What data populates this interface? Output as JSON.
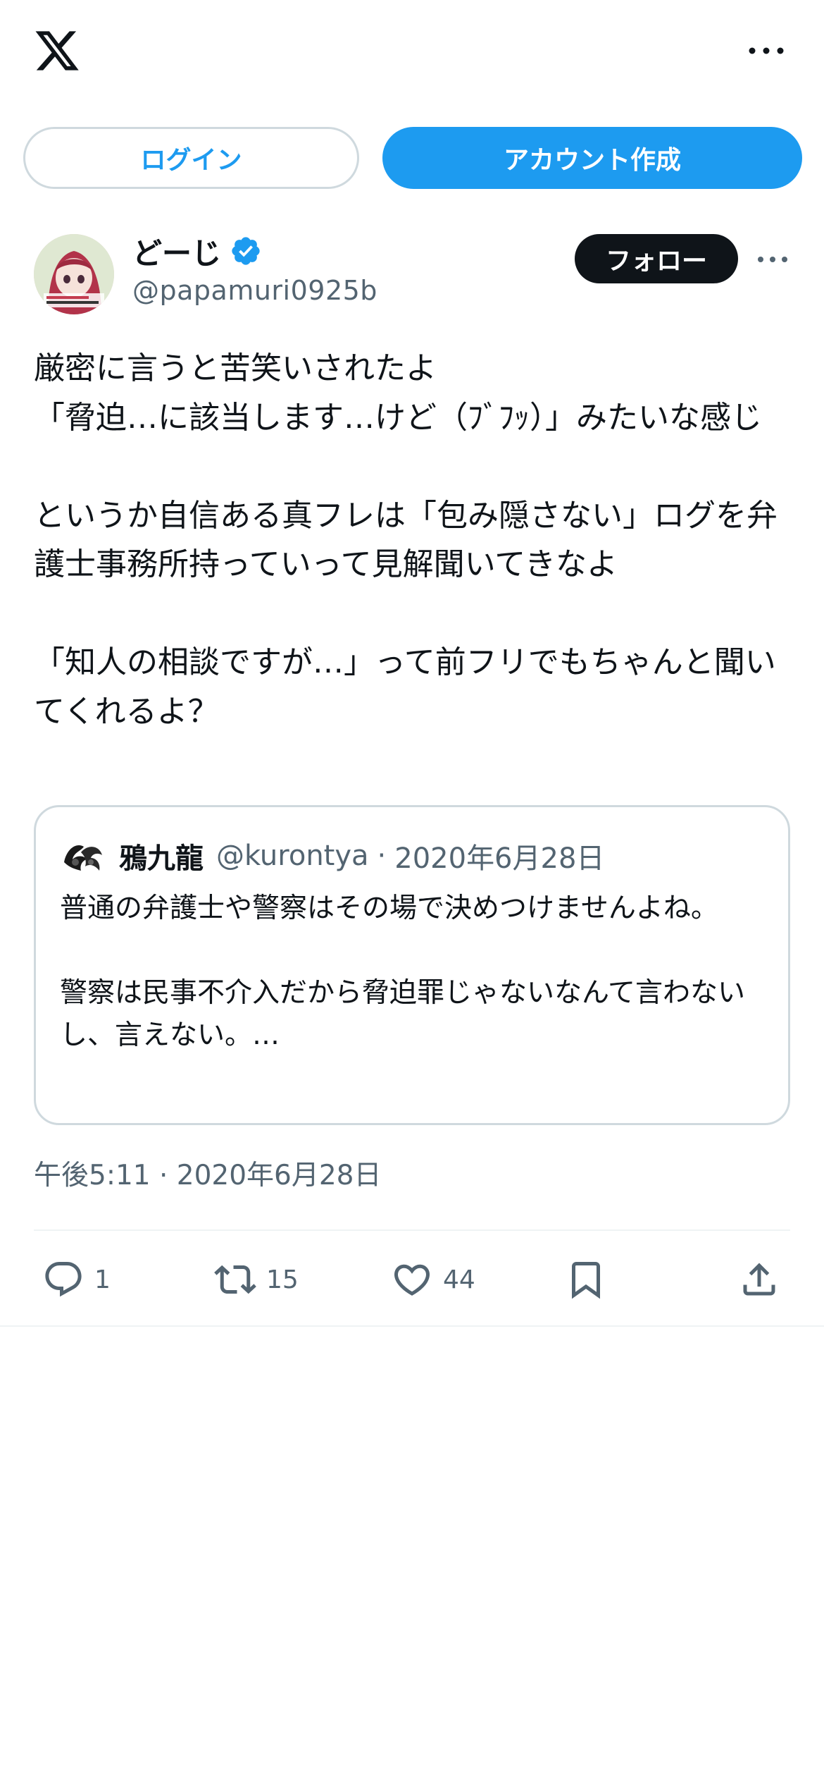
{
  "topbar": {
    "logo_icon": "x-logo-icon",
    "more_icon": "more-horizontal-icon"
  },
  "auth": {
    "login_label": "ログイン",
    "signup_label": "アカウント作成"
  },
  "tweet": {
    "author": {
      "display_name": "どーじ",
      "handle": "@papamuri0925b",
      "verified_icon": "verified-badge-icon"
    },
    "follow_label": "フォロー",
    "text": "厳密に言うと苦笑いされたよ\n「脅迫…に該当します…けど（ﾌﾞﾌｯ）」みたいな感じ\n\nというか自信ある真フレは「包み隠さない」ログを弁護士事務所持っていって見解聞いてきなよ\n\n「知人の相談ですが…」って前フリでもちゃんと聞いてくれるよ？",
    "quoted": {
      "display_name": "鴉九龍",
      "handle": "@kurontya",
      "separator": "·",
      "date": "2020年6月28日",
      "text": "普通の弁護士や警察はその場で決めつけませんよね。\n\n警察は民事不介入だから脅迫罪じゃないなんて言わないし、言えない。…"
    },
    "timestamp": "午後5:11 · 2020年6月28日",
    "stats": {
      "replies": "1",
      "retweets": "15",
      "likes": "44"
    }
  },
  "colors": {
    "accent": "#1d9bf0",
    "text_primary": "#0f1419",
    "text_secondary": "#536471",
    "border": "#cfd9de"
  }
}
